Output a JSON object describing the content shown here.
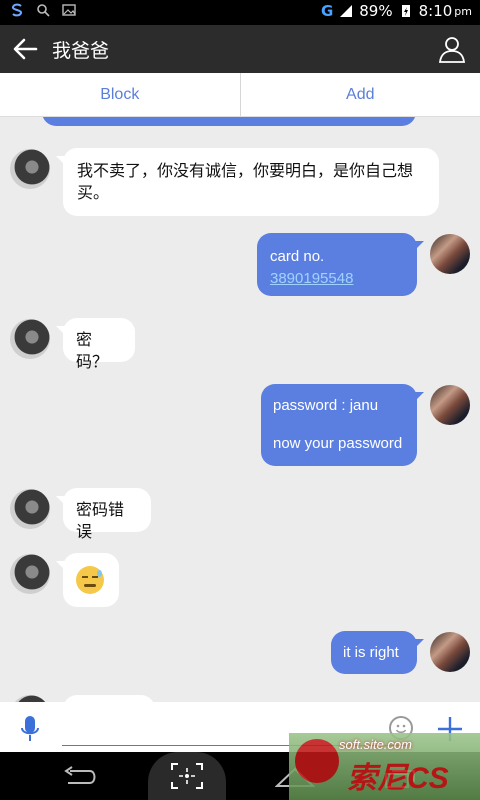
{
  "status_bar": {
    "network": "G",
    "battery": "89%",
    "time": "8:10",
    "ampm": "pm"
  },
  "header": {
    "back_icon": "back-arrow-icon",
    "title": "我爸爸",
    "profile_icon": "person-icon"
  },
  "actions": {
    "block_label": "Block",
    "add_label": "Add"
  },
  "messages": [
    {
      "side": "in",
      "text": "我不卖了，你没有诚信，你要明白，是你自己想买。"
    },
    {
      "side": "out",
      "prefix": "card no. ",
      "link": "3890195548"
    },
    {
      "side": "in",
      "text": "密码？"
    },
    {
      "side": "out",
      "line1": "password : janu",
      "line2": "now your password"
    },
    {
      "side": "in",
      "text": "密码错误"
    },
    {
      "side": "in",
      "emoji": "sweat-smile-emoji"
    },
    {
      "side": "out",
      "text": "it is right"
    }
  ],
  "input": {
    "mic_icon": "microphone-icon",
    "emoji_icon": "smiley-icon",
    "add_icon": "plus-icon"
  },
  "watermark": {
    "top_text": "soft.site.com",
    "big_text": "索尼CS"
  },
  "colors": {
    "accent": "#5b7fe0",
    "header_bg": "#2c2c2c",
    "chat_bg": "#ececec"
  }
}
